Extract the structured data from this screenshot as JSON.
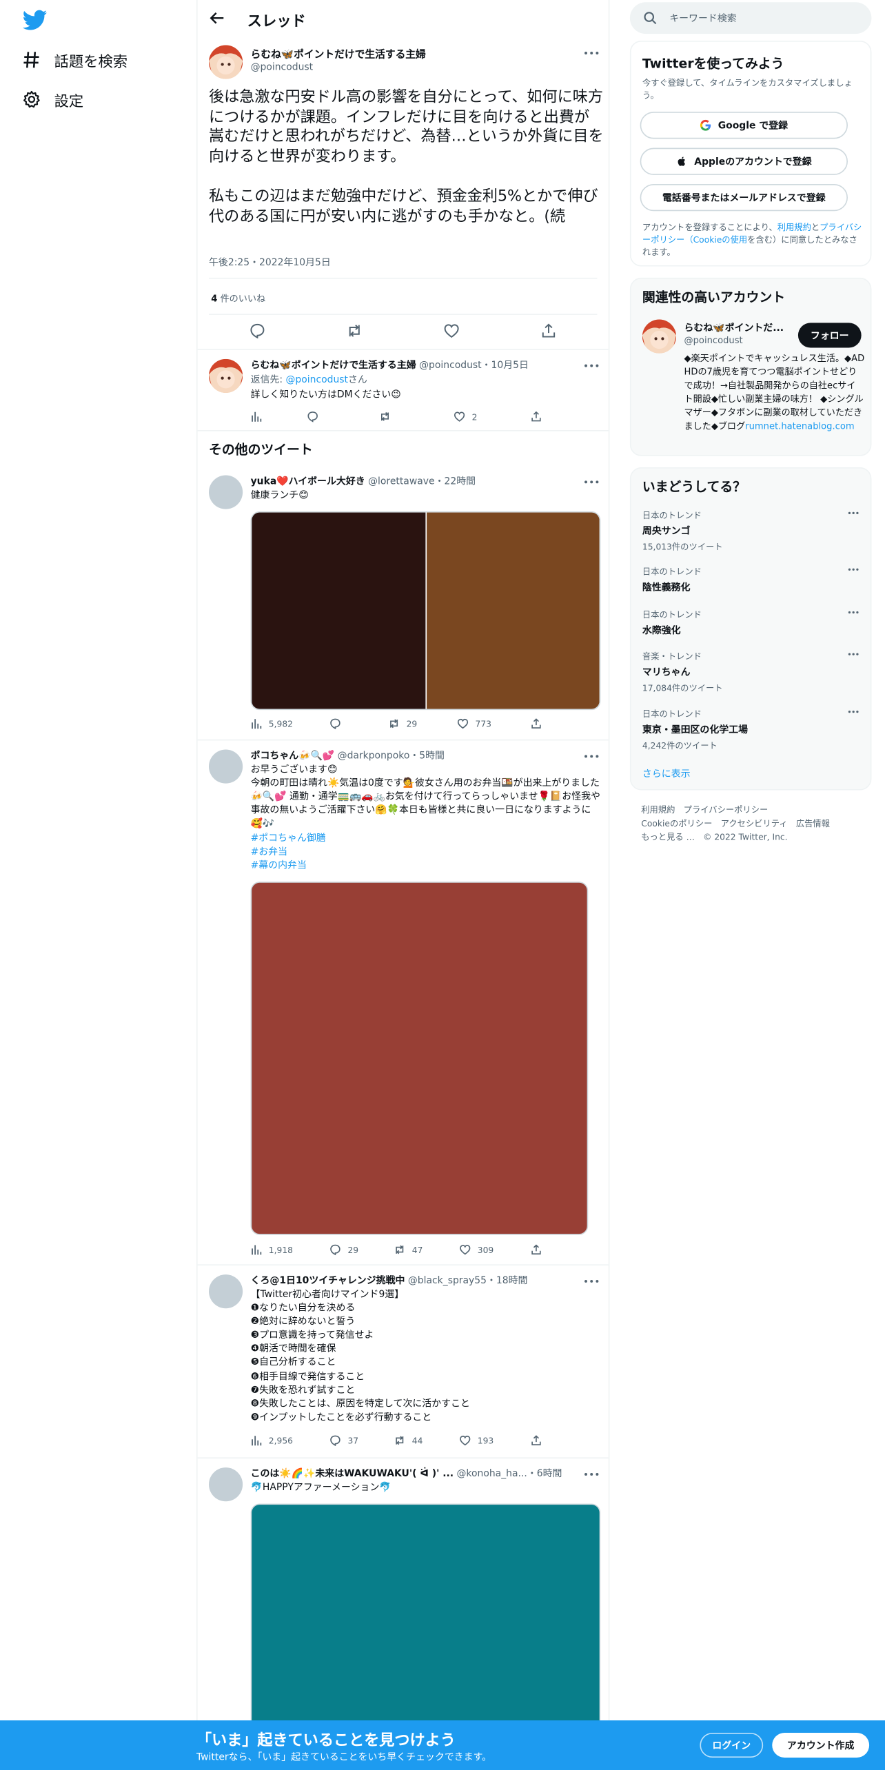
{
  "nav": {
    "items": [
      {
        "label": "話題を検索",
        "icon": "hashtag-icon"
      },
      {
        "label": "設定",
        "icon": "gear-icon"
      }
    ]
  },
  "header": {
    "title": "スレッド"
  },
  "main_tweet": {
    "name": "らむね🦋ポイントだけで生活する主婦",
    "handle": "@poincodust",
    "body": "後は急激な円安ドル高の影響を自分にとって、如何に味方につけるかが課題。インフレだけに目を向けると出費が嵩むだけと思われがちだけど、為替…というか外貨に目を向けると世界が変わります。\n\n私もこの辺はまだ勉強中だけど、預金金利5%とかで伸び代のある国に円が安い内に逃がすのも手かなと。(続",
    "timestamp": "午後2:25・2022年10月5日",
    "likes_count": "4",
    "likes_label": " 件のいいね"
  },
  "reply": {
    "name": "らむね🦋ポイントだけで生活する主婦",
    "handle": "@poincodust",
    "date": "・10月5日",
    "reply_to_prefix": "返信先: ",
    "reply_to_handle": "@poincodust",
    "reply_to_suffix": "さん",
    "text": "詳しく知りたい方はDMください😉",
    "likes": "2"
  },
  "more_tweets_title": "その他のツイート",
  "tweets": [
    {
      "name": "yuka❤️ハイボール大好き",
      "handle": "@lorettawave",
      "time": "・22時間",
      "text": "健康ランチ😊",
      "views": "5,982",
      "replies": "",
      "retweets": "29",
      "likes": "773"
    },
    {
      "name": "ポコちゃん🍻🔍💕",
      "handle": "@darkponpoko",
      "time": "・5時間",
      "text": "お早うございます😊\n今朝の町田は晴れ☀️気温は0度です💁彼女さん用のお弁当🍱が出来上がりました🍻🔍💕 通勤・通学🚃🚌🚗🚲お気を付けて行ってらっしゃいませ🌹📔お怪我や事故の無いようご活躍下さい🤗🍀本日も皆様と共に良い一日になりますように🥰🎶",
      "hashtags": [
        "#ポコちゃん御膳",
        "#お弁当",
        "#幕の内弁当"
      ],
      "views": "1,918",
      "replies": "29",
      "retweets": "47",
      "likes": "309"
    },
    {
      "name": "くろ@1日10ツイチャレンジ挑戦中",
      "handle": "@black_spray55",
      "time": "・18時間",
      "text": "【Twitter初心者向けマインド9選】\n❶なりたい自分を決める\n❷絶対に辞めないと誓う\n❸プロ意識を持って発信せよ\n❹朝活で時間を確保\n❺自己分析すること\n❻相手目線で発信すること\n❼失敗を恐れず試すこと\n❽失敗したことは、原因を特定して次に活かすこと\n❾インプットしたことを必ず行動すること",
      "views": "2,956",
      "replies": "37",
      "retweets": "44",
      "likes": "193"
    },
    {
      "name": "このは☀️🌈✨未来はWAKUWAKU'( ᐛ )' ...",
      "handle": "@konoha_ha...",
      "time": "・6時間",
      "text": "🐬HAPPYアファーメーション🐬"
    }
  ],
  "search": {
    "placeholder": "キーワード検索"
  },
  "signup_card": {
    "title": "Twitterを使ってみよう",
    "subtitle": "今すぐ登録して、タイムラインをカスタマイズしましょう。",
    "google": "Google で登録",
    "apple": "Appleのアカウントで登録",
    "phone": "電話番号またはメールアドレスで登録",
    "legal_prefix": "アカウントを登録することにより、",
    "terms": "利用規約",
    "and": "と",
    "privacy": "プライバシーポリシー（Cookieの使用",
    "legal_suffix": "を含む）に同意したとみなされます。"
  },
  "related_card": {
    "title": "関連性の高いアカウント",
    "name": "らむね🦋ポイントだ...",
    "handle": "@poincodust",
    "follow": "フォロー",
    "bio": "◆楽天ポイントでキャッシュレス生活。◆ADHDの7歳児を育てつつ電脳ポイントせどりで成功！→自社製品開発からの自社ecサイト開設◆忙しい副業主婦の味方！ ◆シングルマザー◆フタボンに副業の取材していただきました◆ブログ",
    "bio_link": "rumnet.hatenablog.com"
  },
  "trends_card": {
    "title": "いまどうしてる？",
    "trends": [
      {
        "context": "日本のトレンド",
        "title": "周央サンゴ",
        "count": "15,013件のツイート"
      },
      {
        "context": "日本のトレンド",
        "title": "陰性義務化",
        "count": ""
      },
      {
        "context": "日本のトレンド",
        "title": "水際強化",
        "count": ""
      },
      {
        "context": "音楽・トレンド",
        "title": "マリちゃん",
        "count": "17,084件のツイート"
      },
      {
        "context": "日本のトレンド",
        "title": "東京・墨田区の化学工場",
        "count": "4,242件のツイート"
      }
    ],
    "show_more": "さらに表示"
  },
  "footer": {
    "line1": "利用規約　プライバシーポリシー",
    "line2": "Cookieのポリシー　アクセシビリティ　広告情報",
    "line3": "もっと見る …　© 2022 Twitter, Inc."
  },
  "bottom_bar": {
    "title": "「いま」起きていることを見つけよう",
    "subtitle": "Twitterなら、「いま」起きていることをいち早くチェックできます。",
    "login": "ログイン",
    "signup": "アカウント作成"
  },
  "colors": {
    "accent": "#1d9bf0",
    "media1_left": "#2a1310",
    "media1_right": "#7a4720",
    "media2": "#983f35",
    "media3": "#087e8a"
  }
}
